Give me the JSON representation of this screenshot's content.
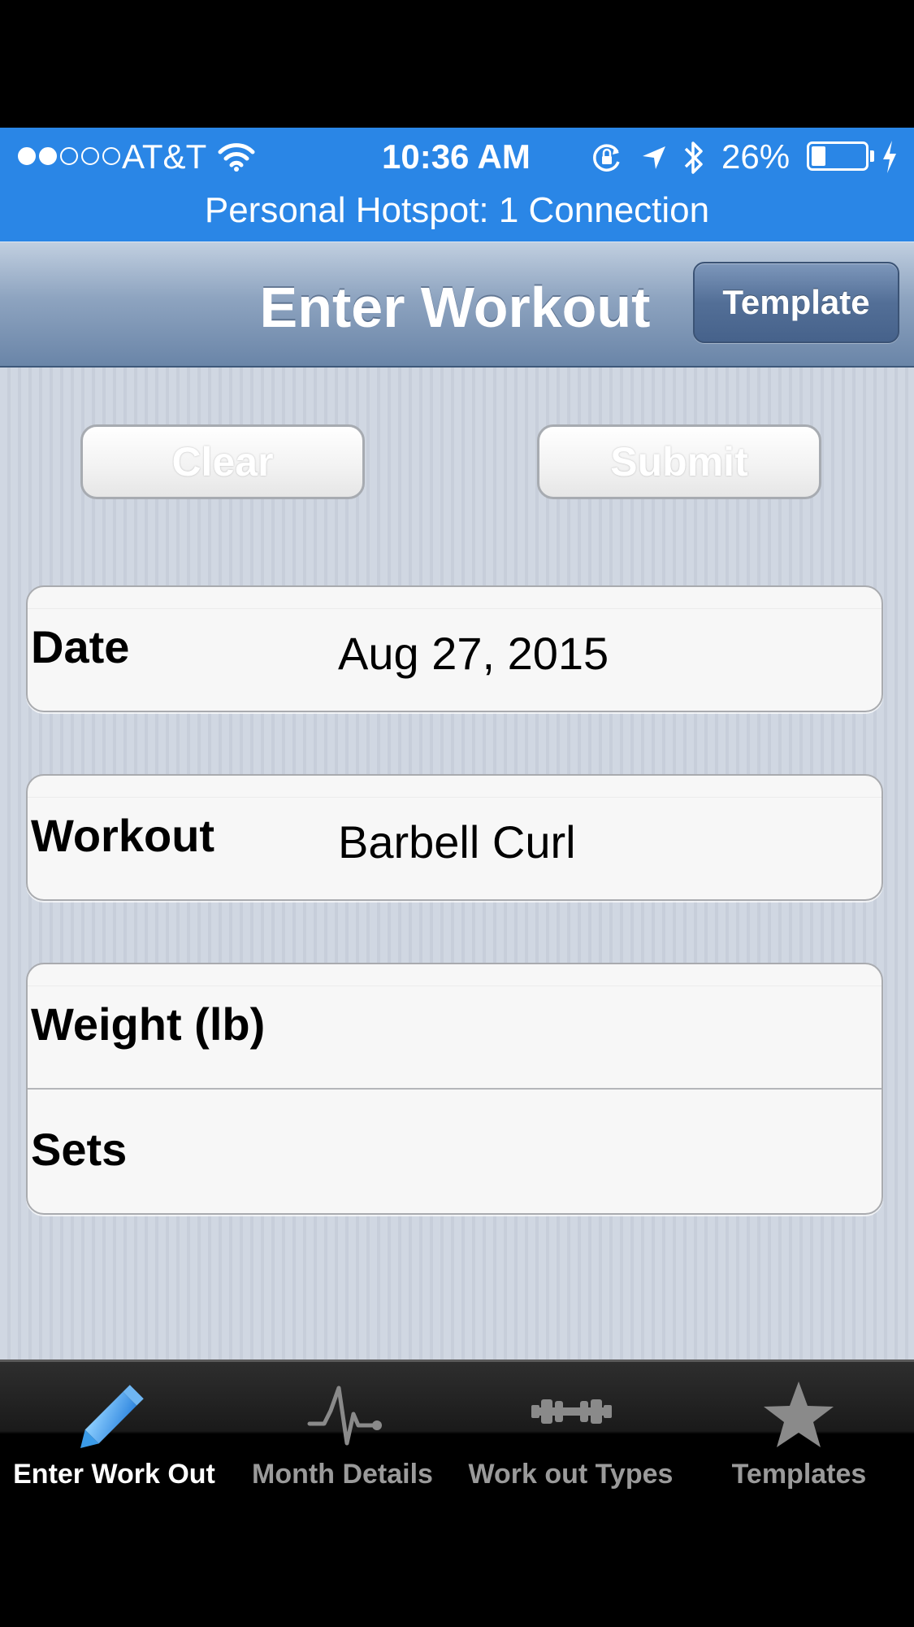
{
  "status_bar": {
    "signal_dots_filled": 2,
    "signal_dots_total": 5,
    "carrier": "AT&T",
    "wifi_icon": "wifi-icon",
    "time": "10:36 AM",
    "orientation_lock_icon": "orientation-lock-icon",
    "location_icon": "location-arrow-icon",
    "bluetooth_icon": "bluetooth-icon",
    "battery_percent": "26%",
    "battery_level": 0.26,
    "charging_icon": "charging-bolt-icon",
    "hotspot_text": "Personal Hotspot: 1 Connection",
    "background_color": "#2a86e6"
  },
  "nav": {
    "title": "Enter Workout",
    "template_button": "Template"
  },
  "actions": {
    "clear_label": "Clear",
    "submit_label": "Submit"
  },
  "form": {
    "date": {
      "label": "Date",
      "value": "Aug 27, 2015"
    },
    "workout": {
      "label": "Workout",
      "value": "Barbell Curl"
    },
    "weight": {
      "label": "Weight (lb)",
      "value": ""
    },
    "sets": {
      "label": "Sets",
      "value": ""
    }
  },
  "tabs": [
    {
      "label": "Enter Work Out",
      "icon": "pencil-icon",
      "active": true
    },
    {
      "label": "Month Details",
      "icon": "pulse-icon",
      "active": false
    },
    {
      "label": "Work out Types",
      "icon": "dumbbell-icon",
      "active": false
    },
    {
      "label": "Templates",
      "icon": "star-icon",
      "active": false
    }
  ],
  "colors": {
    "tab_active_icon": "#3b9be8",
    "tab_inactive_icon": "#8a8a8a"
  }
}
